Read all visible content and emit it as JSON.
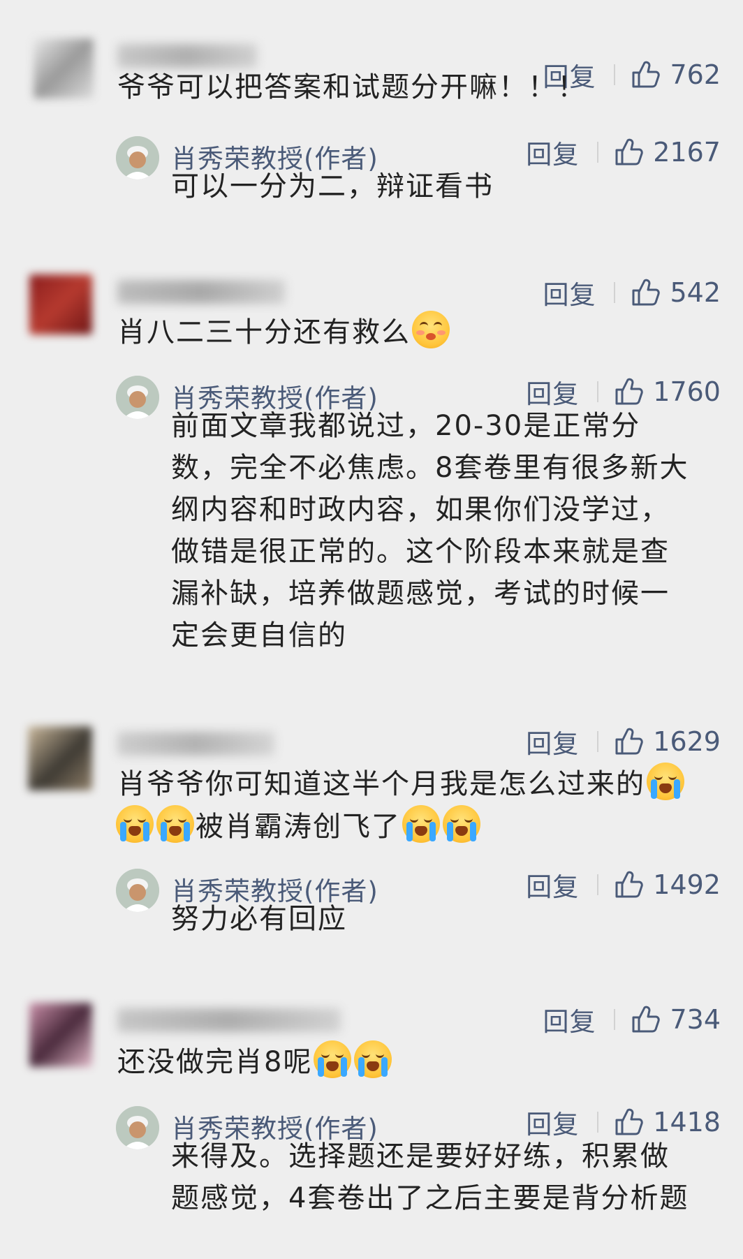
{
  "reply_label": "回复",
  "author_name": "肖秀荣教授(作者)",
  "comments": [
    {
      "likes": "762",
      "text": "爷爷可以把答案和试题分开嘛！！！",
      "reply": {
        "likes": "2167",
        "text": "可以一分为二，辩证看书"
      }
    },
    {
      "likes": "542",
      "text": "肖八二三十分还有救么",
      "reply": {
        "likes": "1760",
        "text_lines": [
          "前面文章我都说过，20-30是正常分",
          "数，完全不必焦虑。8套卷里有很多新大",
          "纲内容和时政内容，如果你们没学过，",
          "做错是很正常的。这个阶段本来就是查",
          "漏补缺，培养做题感觉，考试的时候一",
          "定会更自信的"
        ]
      }
    },
    {
      "likes": "1629",
      "text_line1": "肖爷爷你可知道这半个月我是怎么过来的",
      "text_line2": "被肖霸涛创飞了",
      "reply": {
        "likes": "1492",
        "text": "努力必有回应"
      }
    },
    {
      "likes": "734",
      "text": "还没做完肖8呢",
      "reply": {
        "likes": "1418",
        "text_lines": [
          "来得及。选择题还是要好好练，积累做",
          "题感觉，4套卷出了之后主要是背分析题"
        ]
      }
    }
  ],
  "icons": {
    "like": "thumbs-up-icon",
    "emoji_cry": "crying-face-icon",
    "emoji_shy": "shy-face-icon"
  },
  "colors": {
    "background": "#eeeeee",
    "link": "#4a5a78",
    "text": "#222222"
  }
}
